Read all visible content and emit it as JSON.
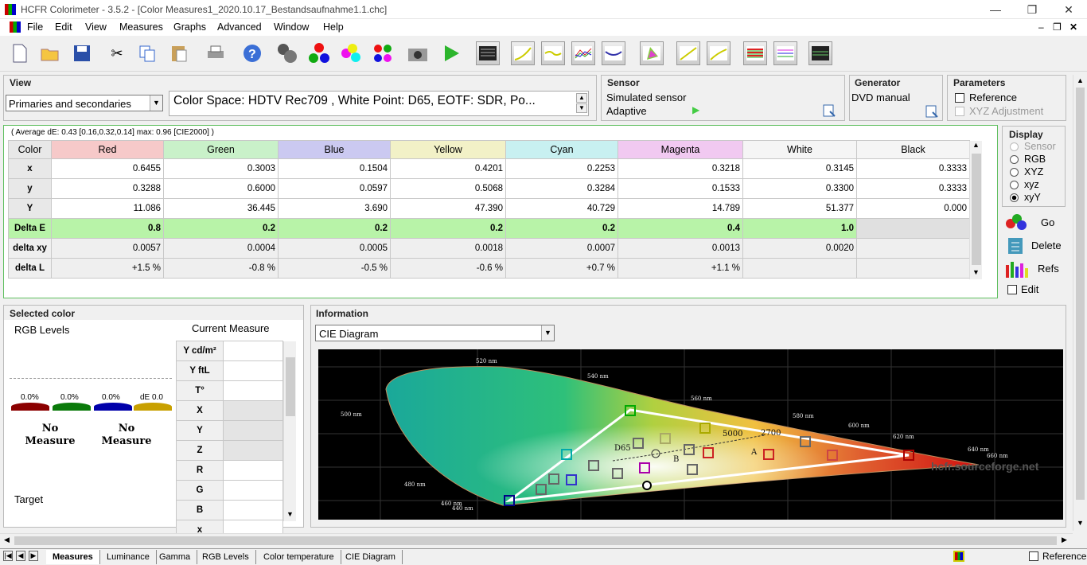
{
  "window": {
    "title": "HCFR Colorimeter - 3.5.2 - [Color Measures1_2020.10.17_Bestandsaufnahme1.1.chc]"
  },
  "menu": [
    "File",
    "Edit",
    "View",
    "Measures",
    "Graphs",
    "Advanced",
    "Window",
    "Help"
  ],
  "view": {
    "label": "View",
    "mode": "Primaries and secondaries",
    "colorspace": "Color Space: HDTV Rec709 , White Point: D65, EOTF:  SDR, Po..."
  },
  "sensor": {
    "label": "Sensor",
    "name": "Simulated sensor",
    "mode": "Adaptive"
  },
  "generator": {
    "label": "Generator",
    "name": "DVD manual"
  },
  "parameters": {
    "label": "Parameters",
    "reference": "Reference",
    "xyz_adjust": "XYZ Adjustment"
  },
  "display": {
    "label": "Display",
    "options": [
      "Sensor",
      "RGB",
      "XYZ",
      "xyz",
      "xyY"
    ],
    "selected": "xyY",
    "go": "Go",
    "delete": "Delete",
    "refs": "Refs",
    "edit": "Edit"
  },
  "summary": "( Average dE: 0.43 [0.16,0.32,0.14] max: 0.96 [CIE2000] )",
  "table": {
    "corner": "Color",
    "columns": [
      {
        "name": "Red",
        "bg": "#f6c9c9"
      },
      {
        "name": "Green",
        "bg": "#c9f1c9"
      },
      {
        "name": "Blue",
        "bg": "#cbc9f1"
      },
      {
        "name": "Yellow",
        "bg": "#f2f1c7"
      },
      {
        "name": "Cyan",
        "bg": "#c8f0f1"
      },
      {
        "name": "Magenta",
        "bg": "#f1c9f1"
      },
      {
        "name": "White",
        "bg": "#f5f5f5"
      },
      {
        "name": "Black",
        "bg": "#f5f5f5"
      }
    ],
    "rows": [
      {
        "label": "x",
        "values": [
          "0.6455",
          "0.3003",
          "0.1504",
          "0.4201",
          "0.2253",
          "0.3218",
          "0.3145",
          "0.3333"
        ]
      },
      {
        "label": "y",
        "values": [
          "0.3288",
          "0.6000",
          "0.0597",
          "0.5068",
          "0.3284",
          "0.1533",
          "0.3300",
          "0.3333"
        ]
      },
      {
        "label": "Y",
        "values": [
          "11.086",
          "36.445",
          "3.690",
          "47.390",
          "40.729",
          "14.789",
          "51.377",
          "0.000"
        ]
      },
      {
        "label": "Delta E",
        "values": [
          "0.8",
          "0.2",
          "0.2",
          "0.2",
          "0.2",
          "0.4",
          "1.0",
          ""
        ]
      },
      {
        "label": "delta xy",
        "values": [
          "0.0057",
          "0.0004",
          "0.0005",
          "0.0018",
          "0.0007",
          "0.0013",
          "0.0020",
          ""
        ]
      },
      {
        "label": "delta L",
        "values": [
          "+1.5 %",
          "-0.8 %",
          "-0.5 %",
          "-0.6 %",
          "+0.7 %",
          "+1.1 %",
          "",
          ""
        ]
      }
    ]
  },
  "selected": {
    "label": "Selected color",
    "rgb_levels": "RGB Levels",
    "current": "Current Measure",
    "pct": [
      "0.0%",
      "0.0%",
      "0.0%",
      "dE 0.0"
    ],
    "no_measure": "No Measure",
    "target": "Target",
    "rows": [
      "Y cd/m²",
      "Y ftL",
      "T°",
      "X",
      "Y",
      "Z",
      "R",
      "G",
      "B",
      "x"
    ]
  },
  "information": {
    "label": "Information",
    "selected": "CIE Diagram",
    "watermark": "hcfr.sourceforge.net",
    "wavelengths": [
      "520 nm",
      "540 nm",
      "560 nm",
      "580 nm",
      "600 nm",
      "620 nm",
      "640 nm",
      "660 nm",
      "500 nm",
      "480 nm",
      "460 nm",
      "440 nm"
    ],
    "annot": [
      "D65",
      "5000",
      "2700",
      "A",
      "B"
    ]
  },
  "tabs": [
    "Measures",
    "Luminance",
    "Gamma",
    "RGB Levels",
    "Color temperature",
    "CIE Diagram"
  ],
  "status": {
    "reference": "Reference"
  }
}
